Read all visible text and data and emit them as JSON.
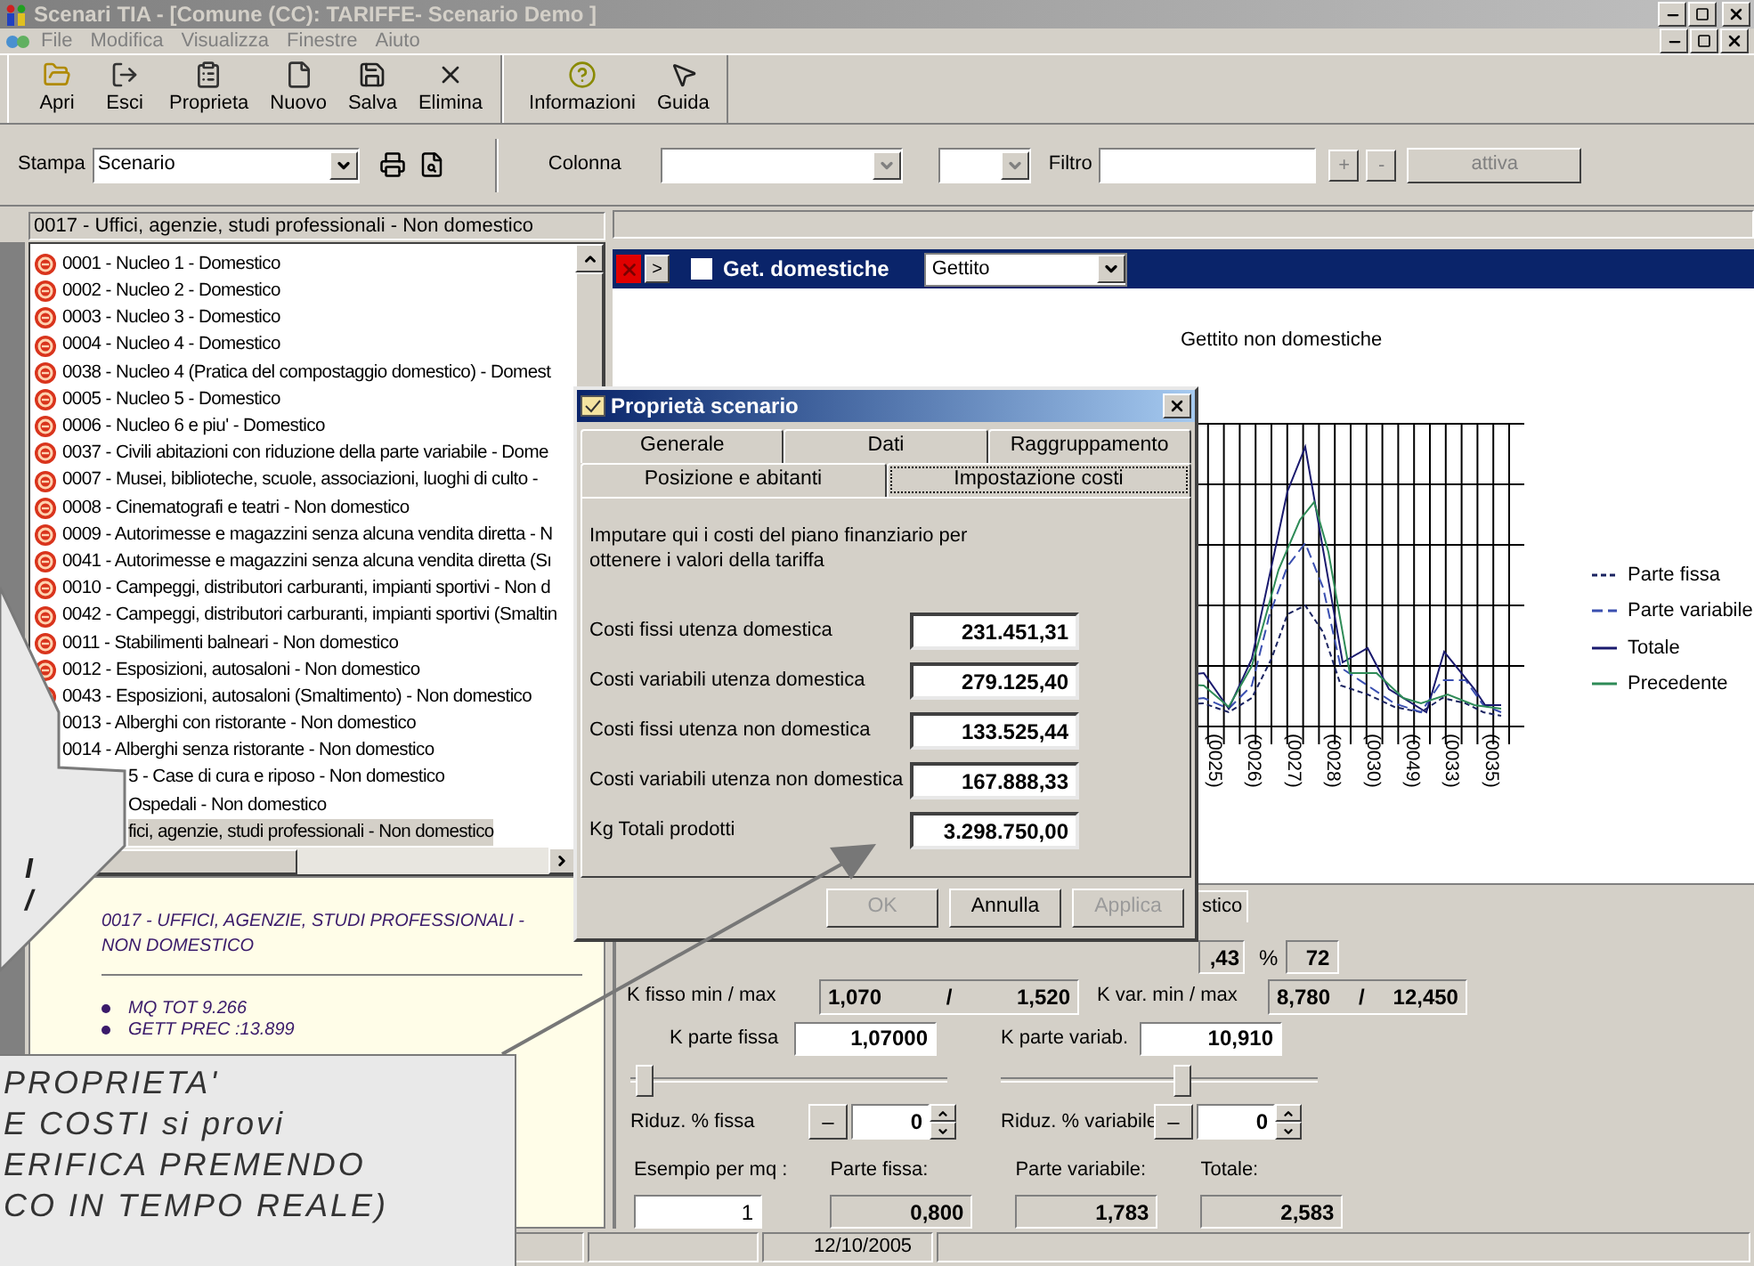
{
  "window": {
    "title": "Scenari TIA - [Comune  (CC): TARIFFE- Scenario Demo ]"
  },
  "menu": [
    {
      "label": "File",
      "disabled": true
    },
    {
      "label": "Modifica",
      "disabled": true
    },
    {
      "label": "Visualizza",
      "disabled": true
    },
    {
      "label": "Finestre",
      "disabled": true
    },
    {
      "label": "Aiuto",
      "disabled": true
    }
  ],
  "toolbar": [
    {
      "items": [
        {
          "label": "Apri",
          "kind": "open"
        },
        {
          "label": "Esci",
          "kind": "exit"
        },
        {
          "label": "Proprieta",
          "kind": "properties"
        },
        {
          "label": "Nuovo",
          "kind": "new"
        },
        {
          "label": "Salva",
          "kind": "save"
        },
        {
          "label": "Elimina",
          "kind": "delete"
        }
      ]
    },
    {
      "items": [
        {
          "label": "Informazioni",
          "kind": "info"
        },
        {
          "label": "Guida",
          "kind": "help"
        }
      ]
    }
  ],
  "print_bar": {
    "label": "Stampa",
    "value": "Scenario"
  },
  "column_bar": {
    "label": "Colonna",
    "filter_label": "Filtro",
    "plus": "+",
    "minus": "-",
    "apply": "attiva"
  },
  "category_header": "0017 - Uffici, agenzie, studi professionali - Non domestico",
  "categories": [
    {
      "label": "0001 - Nucleo 1 - Domestico",
      "kind": "full",
      "selected": false
    },
    {
      "label": "0002 - Nucleo 2 - Domestico",
      "kind": "full",
      "selected": false
    },
    {
      "label": "0003 - Nucleo 3 - Domestico",
      "kind": "full",
      "selected": false
    },
    {
      "label": "0004 - Nucleo 4 - Domestico",
      "kind": "full",
      "selected": false
    },
    {
      "label": "0038 - Nucleo 4 (Pratica del compostaggio domestico) - Domest",
      "kind": "full",
      "selected": false
    },
    {
      "label": "0005 - Nucleo 5 - Domestico",
      "kind": "full",
      "selected": false
    },
    {
      "label": "0006 - Nucleo 6 e piu' - Domestico",
      "kind": "full",
      "selected": false
    },
    {
      "label": "0037 - Civili abitazioni con riduzione della parte variabile - Dome",
      "kind": "full",
      "selected": false
    },
    {
      "label": "0007 - Musei, biblioteche, scuole, associazioni, luoghi di culto -",
      "kind": "full",
      "selected": false
    },
    {
      "label": "0008 - Cinematografi e teatri - Non domestico",
      "kind": "full",
      "selected": false
    },
    {
      "label": "0009 - Autorimesse e magazzini senza alcuna vendita diretta - N",
      "kind": "full",
      "selected": false
    },
    {
      "label": "0041 - Autorimesse e magazzini senza alcuna vendita diretta (Sı",
      "kind": "full",
      "selected": false
    },
    {
      "label": "0010 - Campeggi, distributori carburanti, impianti sportivi - Non d",
      "kind": "full",
      "selected": false
    },
    {
      "label": "0042 - Campeggi, distributori carburanti, impianti sportivi (Smaltin",
      "kind": "full",
      "selected": false
    },
    {
      "label": "0011 - Stabilimenti balneari - Non domestico",
      "kind": "full",
      "selected": false
    },
    {
      "label": "0012 - Esposizioni, autosaloni - Non domestico",
      "kind": "full",
      "selected": false
    },
    {
      "label": "0043 - Esposizioni, autosaloni (Smaltimento) - Non domestico",
      "kind": "full",
      "selected": false
    },
    {
      "label": "0013 - Alberghi con ristorante - Non domestico",
      "kind": "noicon",
      "selected": false
    },
    {
      "label": "0014 - Alberghi senza ristorante - Non domestico",
      "kind": "noicon",
      "selected": false
    },
    {
      "label": "5 - Case di cura e riposo - Non domestico",
      "kind": "cut",
      "selected": false
    },
    {
      "label": "Ospedali - Non domestico",
      "kind": "cut",
      "selected": false
    },
    {
      "label": "fici, agenzie, studi professionali - Non domestico",
      "kind": "cut",
      "selected": true
    }
  ],
  "info": {
    "title": "0017 - UFFICI, AGENZIE, STUDI PROFESSIONALI - NON DOMESTICO",
    "bullets": [
      "MQ TOT 9.266",
      "GETT PREC :13.899"
    ]
  },
  "chart_bar": {
    "arrow": ">",
    "checkbox": {
      "label": "Get. domestiche",
      "checked": false
    },
    "select": "Gettito"
  },
  "chart": {
    "title": "Gettito non domestiche",
    "x_labels": [
      "(0025)",
      "(0026)",
      "(0027)",
      "(0028)",
      "(0030)",
      "(0049)",
      "(0033)",
      "(0035)"
    ],
    "legend": [
      {
        "label": "Parte fissa",
        "color": "#1a2360",
        "kind": "dashed"
      },
      {
        "label": "Parte variabile",
        "color": "#3a4fb0",
        "kind": "longdash"
      },
      {
        "label": "Totale",
        "color": "#1a1a6e",
        "kind": "solid"
      },
      {
        "label": "Precedente",
        "color": "#2e8b57",
        "kind": "solid"
      }
    ]
  },
  "params": {
    "tab": "stico",
    "gettito_tail": ",43",
    "percent_label": "%",
    "percent": "72",
    "k_fisso": {
      "label": "K fisso  min / max",
      "min": "1,070",
      "sep": "/",
      "max": "1,520"
    },
    "k_var": {
      "label": "K var.  min / max",
      "min": "8,780",
      "sep": "/",
      "max": "12,450"
    },
    "k_parte_fissa": {
      "label": "K parte fissa",
      "value": "1,07000"
    },
    "k_parte_variab": {
      "label": "K parte variab.",
      "value": "10,910"
    },
    "riduz": [
      {
        "label": "Riduz. % fissa",
        "minus": "–",
        "value": "0",
        "level": 0.02
      },
      {
        "label": "Riduz. % variabile",
        "minus": "–",
        "value": "0",
        "level": 0.58
      }
    ],
    "example": {
      "label": "Esempio per mq :",
      "value": "1"
    },
    "results": [
      {
        "label": "Parte fissa:",
        "value": "0,800"
      },
      {
        "label": "Parte variabile:",
        "value": "1,783"
      },
      {
        "label": "Totale:",
        "value": "2,583"
      }
    ]
  },
  "status_bar": {
    "date": "12/10/2005"
  },
  "dialog": {
    "title": "Proprietà scenario",
    "tab_rows": [
      [
        {
          "label": "Generale",
          "selected": false
        },
        {
          "label": "Dati",
          "selected": false
        },
        {
          "label": "Raggruppamento",
          "selected": false
        }
      ],
      [
        {
          "label": "Posizione e abitanti",
          "selected": false
        },
        {
          "label": "Impostazione costi",
          "selected": true
        }
      ]
    ],
    "intro": "Imputare qui i costi del piano finanziario per ottenere i valori della tariffa",
    "fields": [
      {
        "label": "Costi fissi utenza domestica",
        "value": "231.451,31"
      },
      {
        "label": "Costi variabili utenza domestica",
        "value": "279.125,40"
      },
      {
        "label": "Costi fissi utenza non domestica",
        "value": "133.525,44"
      },
      {
        "label": "Costi variabili utenza non domestica",
        "value": "167.888,33"
      },
      {
        "label": "Kg Totali prodotti",
        "value": "3.298.750,00"
      }
    ],
    "buttons": [
      {
        "label": "OK",
        "disabled": true
      },
      {
        "label": "Annulla",
        "disabled": false
      },
      {
        "label": "Applica",
        "disabled": true
      }
    ]
  },
  "callouts": {
    "upper": [
      "I",
      "/"
    ],
    "lower": [
      "PROPRIETA'",
      "E COSTI si provi",
      "ERIFICA PREMENDO",
      "CO IN TEMPO REALE)"
    ]
  }
}
